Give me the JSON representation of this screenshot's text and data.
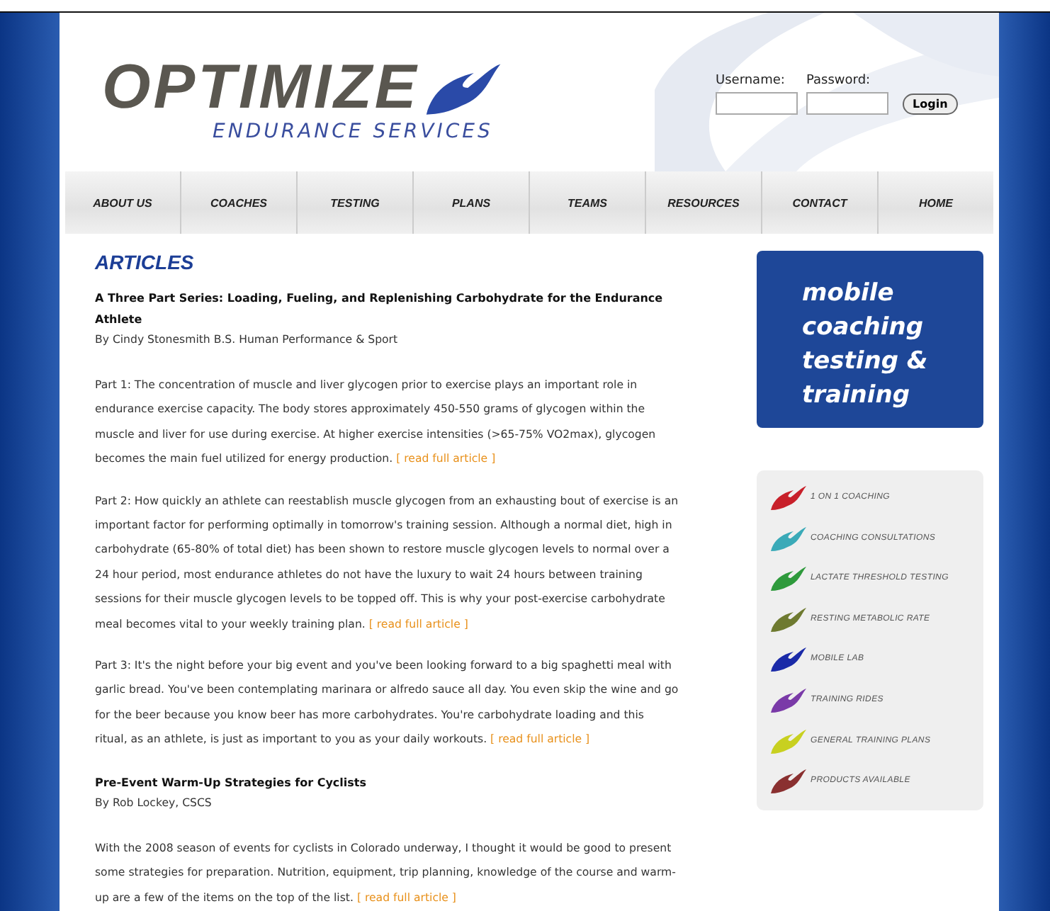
{
  "logo": {
    "name": "OPTIMIZE",
    "tagline": "ENDURANCE SERVICES"
  },
  "login": {
    "username_label": "Username:",
    "password_label": "Password:",
    "button": "Login"
  },
  "nav": [
    "ABOUT US",
    "COACHES",
    "TESTING",
    "PLANS",
    "TEAMS",
    "RESOURCES",
    "CONTACT",
    "HOME"
  ],
  "section_title": "ARTICLES",
  "articles": [
    {
      "title": "A Three Part Series: Loading, Fueling, and Replenishing Carbohydrate for the Endurance Athlete",
      "byline": "By Cindy Stonesmith B.S. Human Performance & Sport",
      "parts": [
        {
          "text": "Part 1: The concentration of muscle and liver glycogen prior to exercise plays an important role in endurance exercise capacity. The body stores approximately 450-550 grams of glycogen within the muscle and liver for use during exercise. At higher exercise intensities (>65-75% VO2max), glycogen becomes the main fuel utilized for energy production.",
          "link": "[ read full article ]"
        },
        {
          "text": "Part 2: How quickly an athlete can reestablish muscle glycogen from an exhausting bout of exercise is an important factor for performing optimally in tomorrow's training session. Although a normal diet, high in carbohydrate (65-80% of total diet) has been shown to restore muscle glycogen levels to normal over a 24 hour period, most endurance athletes do not have the luxury to wait 24 hours between training sessions for their muscle glycogen levels to be topped off. This is why your post-exercise carbohydrate meal becomes vital to your weekly training plan.",
          "link": "[ read full article ]"
        },
        {
          "text": "Part 3: It's the night before your big event and you've been looking forward to a big spaghetti meal with garlic bread. You've been contemplating marinara or alfredo sauce all day. You even skip the wine and go for the beer because you know beer has more carbohydrates. You're carbohydrate loading and this ritual, as an athlete, is just as important to you as your daily workouts.",
          "link": "[ read full article ]"
        }
      ]
    },
    {
      "title": "Pre-Event Warm-Up Strategies for Cyclists",
      "byline": "By Rob Lockey, CSCS",
      "parts": [
        {
          "text": "With the 2008 season of events for cyclists in Colorado underway, I thought it would be good to present some strategies for preparation. Nutrition, equipment, trip planning, knowledge of the course and warm-up are a few of the items on the top of the list.",
          "link": "[ read full article ]"
        }
      ]
    }
  ],
  "promo": {
    "lines": [
      "mobile",
      "coaching",
      "testing &",
      "training"
    ]
  },
  "services": [
    {
      "label": "1 ON 1 COACHING",
      "color": "#c8202a"
    },
    {
      "label": "COACHING CONSULTATIONS",
      "color": "#3aaab8"
    },
    {
      "label": "LACTATE THRESHOLD TESTING",
      "color": "#2e9a3c"
    },
    {
      "label": "RESTING METABOLIC RATE",
      "color": "#6e7a30"
    },
    {
      "label": "MOBILE LAB",
      "color": "#1a2aa8"
    },
    {
      "label": "TRAINING RIDES",
      "color": "#7a3aa8"
    },
    {
      "label": "GENERAL TRAINING PLANS",
      "color": "#c8d020"
    },
    {
      "label": "PRODUCTS AVAILABLE",
      "color": "#8a3030"
    }
  ]
}
